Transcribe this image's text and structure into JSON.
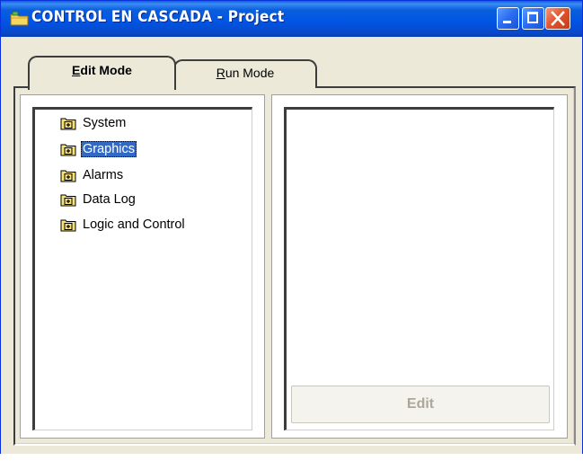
{
  "window": {
    "title": "CONTROL EN CASCADA - Project",
    "title_icon": "project-folder-icon"
  },
  "titlebar_buttons": {
    "minimize": "minimize-icon",
    "maximize": "maximize-icon",
    "close": "close-icon"
  },
  "tabs": [
    {
      "underline": "E",
      "rest": "dit Mode",
      "selected": true
    },
    {
      "underline": "R",
      "rest": "un Mode",
      "selected": false
    }
  ],
  "tree": {
    "items": [
      {
        "label": "System",
        "icon": "folder-plus-icon",
        "selected": false
      },
      {
        "label": "Graphics",
        "icon": "folder-plus-icon",
        "selected": true
      },
      {
        "label": "Alarms",
        "icon": "folder-plus-icon",
        "selected": false
      },
      {
        "label": "Data Log",
        "icon": "folder-plus-icon",
        "selected": false
      },
      {
        "label": "Logic and Control",
        "icon": "folder-plus-icon",
        "selected": false
      }
    ]
  },
  "details": {
    "edit_label": "Edit",
    "edit_enabled": false
  },
  "colors": {
    "titlebar": "#0054e3",
    "window_bg": "#ece9d8",
    "selection": "#316ac5",
    "close_button": "#e0512a",
    "disabled_text": "#aca899"
  }
}
